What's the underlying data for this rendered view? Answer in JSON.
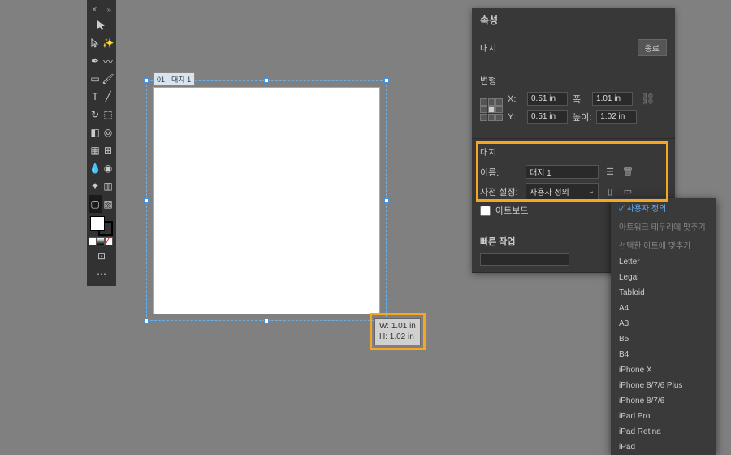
{
  "toolbar": {
    "close": "×",
    "expand": "»"
  },
  "artboard": {
    "label": "01 · 대지 1"
  },
  "dim_badge": {
    "w_label": "W:",
    "w_value": "1.01 in",
    "h_label": "H:",
    "h_value": "1.02 in"
  },
  "panel": {
    "title": "속성",
    "obj_type_label": "대지",
    "obj_type_btn": "종료",
    "transform": {
      "heading": "변형",
      "x_label": "X:",
      "x_value": "0.51 in",
      "y_label": "Y:",
      "y_value": "0.51 in",
      "w_label": "폭:",
      "w_value": "1.01 in",
      "h_label": "높이:",
      "h_value": "1.02 in"
    },
    "artboard_section": {
      "heading": "대지",
      "name_label": "이름:",
      "name_value": "대지 1",
      "preset_label": "사전 설정:",
      "preset_value": "사용자 정의"
    },
    "preset_options": [
      {
        "t": "사용자 정의",
        "sel": true,
        "dim": false
      },
      {
        "t": "아트워크 테두리에 맞추기",
        "sel": false,
        "dim": true
      },
      {
        "t": "선택한 아트에 맞추기",
        "sel": false,
        "dim": true
      },
      {
        "t": "Letter",
        "sel": false,
        "dim": false
      },
      {
        "t": "Legal",
        "sel": false,
        "dim": false
      },
      {
        "t": "Tabloid",
        "sel": false,
        "dim": false
      },
      {
        "t": "A4",
        "sel": false,
        "dim": false
      },
      {
        "t": "A3",
        "sel": false,
        "dim": false
      },
      {
        "t": "B5",
        "sel": false,
        "dim": false
      },
      {
        "t": "B4",
        "sel": false,
        "dim": false
      },
      {
        "t": "iPhone X",
        "sel": false,
        "dim": false
      },
      {
        "t": "iPhone 8/7/6 Plus",
        "sel": false,
        "dim": false
      },
      {
        "t": "iPhone 8/7/6",
        "sel": false,
        "dim": false
      },
      {
        "t": "iPad Pro",
        "sel": false,
        "dim": false
      },
      {
        "t": "iPad Retina",
        "sel": false,
        "dim": false
      },
      {
        "t": "iPad",
        "sel": false,
        "dim": false
      }
    ],
    "artboard_cb": "아트보드",
    "quick": {
      "heading": "빠른 작업"
    }
  }
}
